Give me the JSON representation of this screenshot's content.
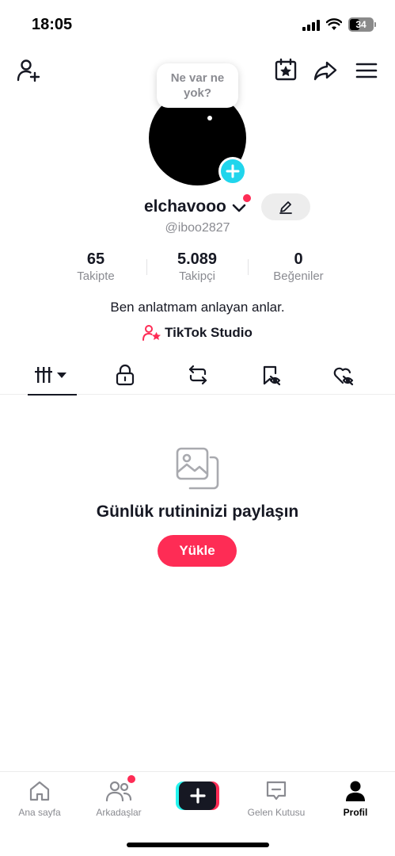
{
  "status_bar": {
    "time": "18:05",
    "battery_level": "34",
    "icons": [
      "cellular-signal-icon",
      "wifi-icon",
      "battery-icon"
    ]
  },
  "top_nav": {
    "icons": [
      "add-friend-icon",
      "calendar-star-icon",
      "share-icon",
      "menu-icon"
    ]
  },
  "profile": {
    "note": "Ne var ne yok?",
    "username": "elchavooo",
    "handle": "@iboo2827",
    "bio": "Ben anlatmam anlayan anlar.",
    "studio_link": "TikTok Studio"
  },
  "stats": [
    {
      "value": "65",
      "label": "Takipte"
    },
    {
      "value": "5.089",
      "label": "Takipçi"
    },
    {
      "value": "0",
      "label": "Beğeniler"
    }
  ],
  "tabs": [
    "videos-grid-icon",
    "lock-icon",
    "repost-icon",
    "favorites-hidden-icon",
    "liked-hidden-icon"
  ],
  "empty_state": {
    "title": "Günlük rutininizi paylaşın",
    "button": "Yükle"
  },
  "bottom_nav": [
    {
      "label": "Ana sayfa",
      "icon": "home-icon"
    },
    {
      "label": "Arkadaşlar",
      "icon": "friends-icon"
    },
    {
      "label": "",
      "icon": "create-plus-icon"
    },
    {
      "label": "Gelen Kutusu",
      "icon": "inbox-icon"
    },
    {
      "label": "Profil",
      "icon": "profile-icon"
    }
  ],
  "colors": {
    "accent_red": "#fe2c55",
    "accent_cyan": "#20d5ec",
    "text_primary": "#161823",
    "text_secondary": "#8a8b91"
  }
}
